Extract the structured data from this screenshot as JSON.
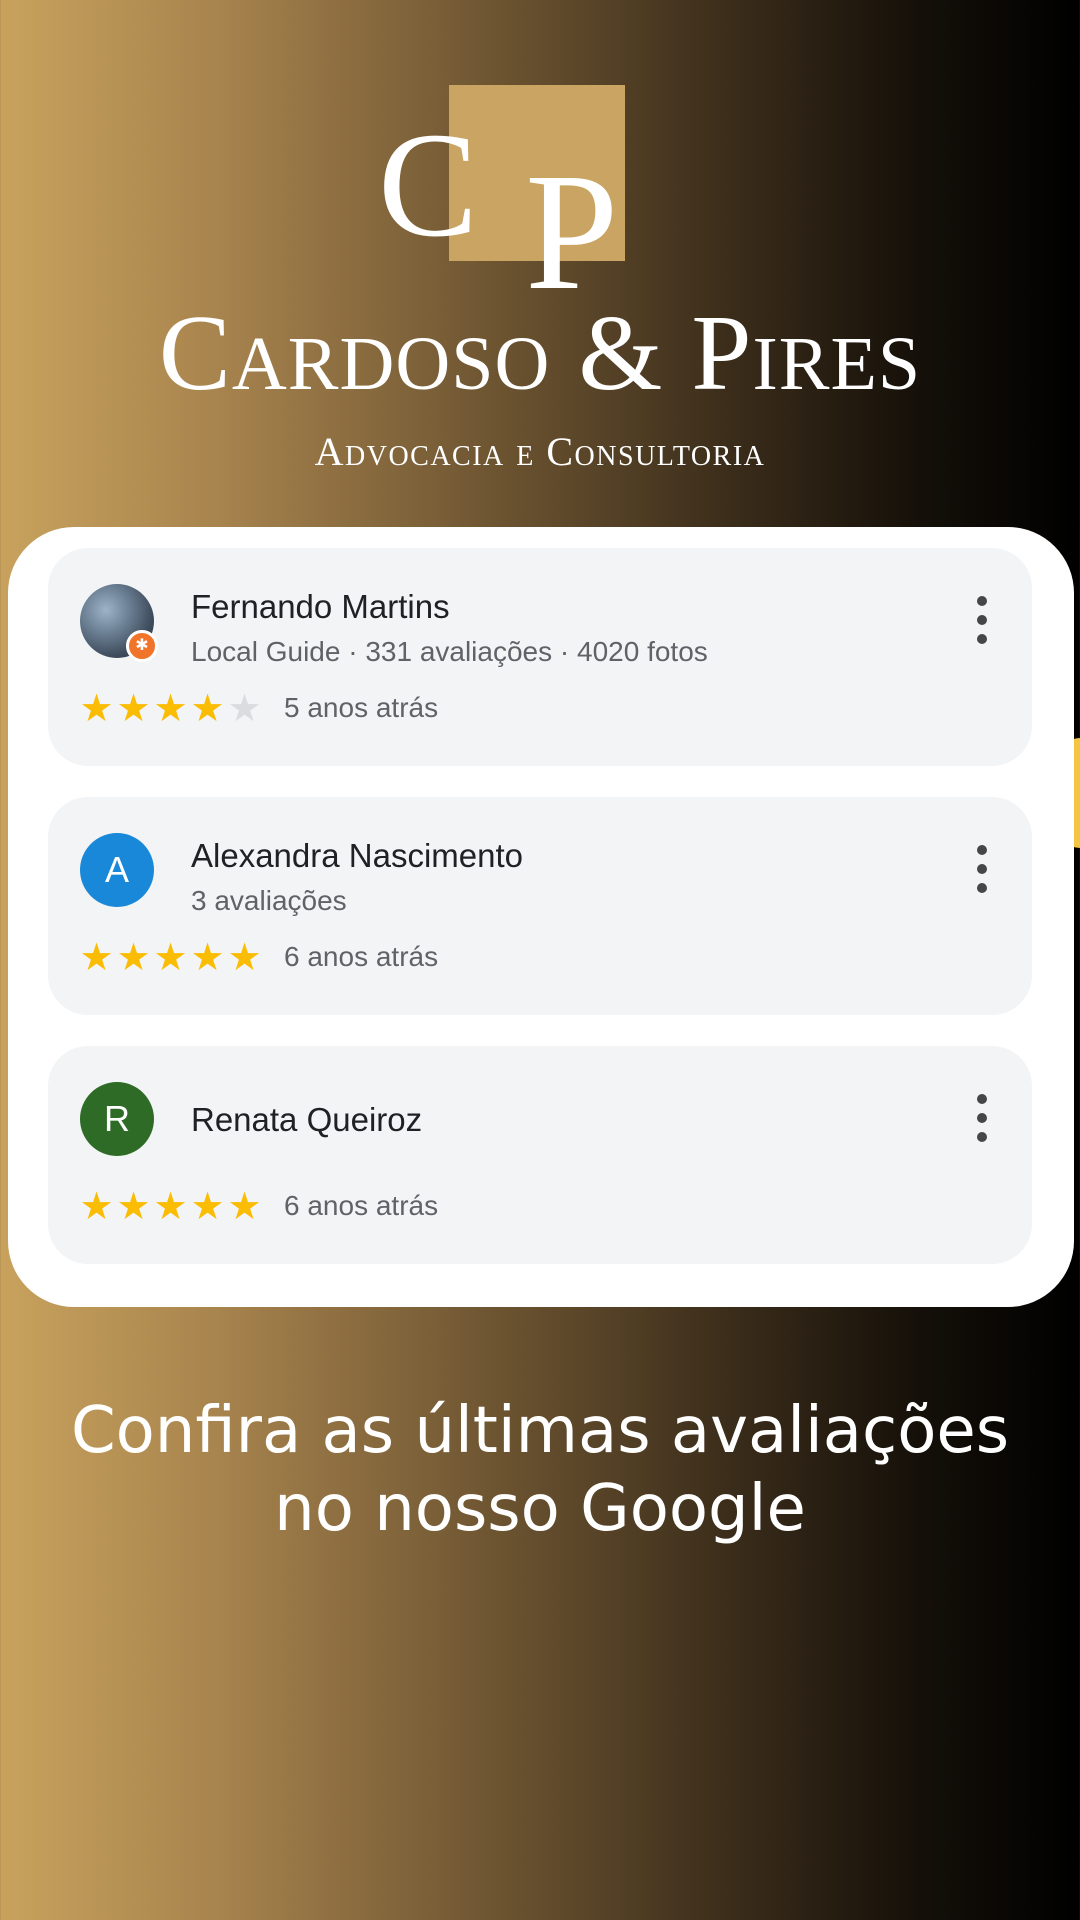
{
  "brand": {
    "logo_letter_c": "C",
    "logo_letter_p": "P",
    "name": "Cardoso & Pires",
    "tagline": "Advocacia e Consultoria",
    "accent_color": "#c9a462"
  },
  "reviews": [
    {
      "name": "Fernando Martins",
      "meta": "Local Guide · 331 avaliações · 4020 fotos",
      "avatar": "photo",
      "rating": 4,
      "date": "5 anos atrás"
    },
    {
      "name": "Alexandra Nascimento",
      "meta": "3 avaliações",
      "avatar_initial": "A",
      "avatar_color": "#1a88d8",
      "rating": 5,
      "date": "6 anos atrás"
    },
    {
      "name": "Renata Queiroz",
      "avatar_initial": "R",
      "avatar_color": "#2e6b26",
      "rating": 5,
      "date": "6 anos atrás"
    }
  ],
  "cta": {
    "line1": "Confira as últimas avaliações",
    "line2": "no nosso Google"
  },
  "icons": {
    "star_color": "#fbbc04",
    "more": "more-vert-icon"
  }
}
